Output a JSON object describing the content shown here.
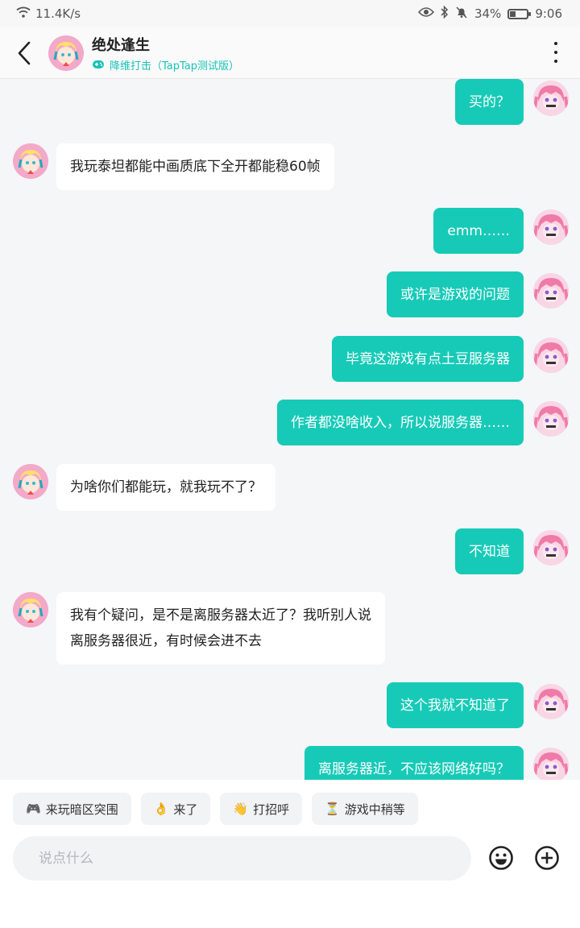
{
  "status_bar": {
    "network_speed": "11.4K/s",
    "battery": "34%",
    "battery_level": 0.34,
    "time": "9:06"
  },
  "header": {
    "title": "绝处逢生",
    "subtitle": "降维打击（TapTap测试版）"
  },
  "messages": [
    {
      "from": "me",
      "text": "买的？"
    },
    {
      "from": "them",
      "text": "我玩泰坦都能中画质底下全开都能稳60帧"
    },
    {
      "from": "me",
      "text": "emm……"
    },
    {
      "from": "me",
      "text": "或许是游戏的问题"
    },
    {
      "from": "me",
      "text": "毕竟这游戏有点土豆服务器"
    },
    {
      "from": "me",
      "text": "作者都没啥收入，所以说服务器……"
    },
    {
      "from": "them",
      "text": "为啥你们都能玩，就我玩不了？"
    },
    {
      "from": "me",
      "text": "不知道"
    },
    {
      "from": "them",
      "text": "我有个疑问，是不是离服务器太近了？我听别人说",
      "text2": "离服务器很近，有时候会进不去"
    },
    {
      "from": "me",
      "text": "这个我就不知道了"
    },
    {
      "from": "me",
      "text": "离服务器近，不应该网络好吗？"
    }
  ],
  "quick_replies": [
    {
      "emoji": "🎮",
      "label": "来玩暗区突围"
    },
    {
      "emoji": "👌",
      "label": "来了"
    },
    {
      "emoji": "👋",
      "label": "打招呼"
    },
    {
      "emoji": "⏳",
      "label": "游戏中稍等"
    }
  ],
  "composer": {
    "placeholder": "说点什么",
    "value": ""
  },
  "icons": {
    "emoji": "smiley-face-icon",
    "add": "plus-circle-icon"
  },
  "colors": {
    "accent": "#17cab7",
    "subtitle": "#19c3b5"
  }
}
